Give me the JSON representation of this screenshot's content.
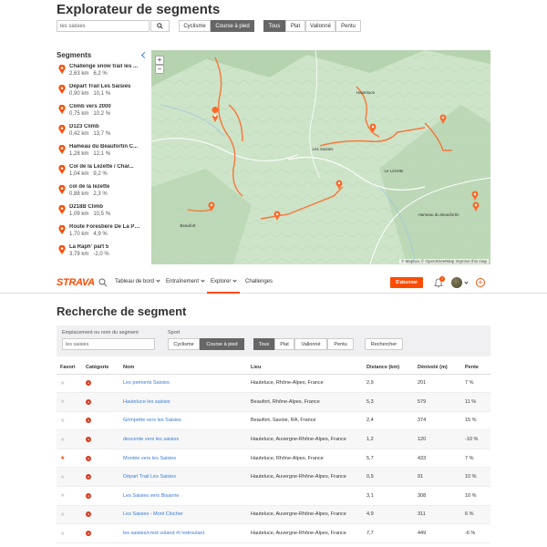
{
  "explorer": {
    "title": "Explorateur de segments",
    "search_value": "les saisies",
    "sport_options": [
      "Cyclisme",
      "Course à pied"
    ],
    "sport_selected": "Course à pied",
    "terrain_options": [
      "Tous",
      "Plat",
      "Vallonné",
      "Pentu"
    ],
    "terrain_selected": "Tous",
    "segments_heading": "Segments",
    "segments": [
      {
        "name": "Challenge snow trail les ...",
        "distance": "2,63 km",
        "grade": "6,2 %"
      },
      {
        "name": "Départ Trail Les Saisies",
        "distance": "0,90 km",
        "grade": "10,1 %"
      },
      {
        "name": "Climb vers 2000",
        "distance": "0,75 km",
        "grade": "10,2 %"
      },
      {
        "name": "D123 Climb",
        "distance": "0,42 km",
        "grade": "13,7 %"
      },
      {
        "name": "Hameau du Beaufortin C...",
        "distance": "1,28 km",
        "grade": "12,1 %"
      },
      {
        "name": "Col de la Lézette / Char...",
        "distance": "1,04 km",
        "grade": "9,2 %"
      },
      {
        "name": "col de la lezette",
        "distance": "0,88 km",
        "grade": "2,3 %"
      },
      {
        "name": "D218B Climb",
        "distance": "1,09 km",
        "grade": "10,5 %"
      },
      {
        "name": "Route Forestière De La Pa...",
        "distance": "1,70 km",
        "grade": "4,9 %"
      },
      {
        "name": "La Raph' part 5",
        "distance": "3,79 km",
        "grade": "-2,0 %"
      }
    ],
    "map": {
      "zoom_in": "+",
      "zoom_out": "−",
      "attribution": "© Mapbox © OpenStreetMap Improve this map",
      "place_labels": [
        "Les Saisies",
        "Hauteluce",
        "Le Lézette",
        "Beaufort",
        "Hameau du Beaufortin"
      ]
    }
  },
  "nav": {
    "logo": "STRAVA",
    "items": [
      "Tableau de bord",
      "Entraînement",
      "Explorer",
      "Challenges"
    ],
    "subscribe": "S'abonner",
    "notif_count": "1",
    "add": "+"
  },
  "search": {
    "title": "Recherche de segment",
    "location_label": "Emplacement ou nom du segment",
    "location_value": "les saisies",
    "sport_label": "Sport",
    "sport_options": [
      "Cyclisme",
      "Course à pied"
    ],
    "terrain_options": [
      "Tous",
      "Plat",
      "Vallonné",
      "Pentu"
    ],
    "submit": "Rechercher"
  },
  "table": {
    "headers": [
      "Favori",
      "Catégorie",
      "Nom",
      "Lieu",
      "Distance (km)",
      "Dénivelé (m)",
      "Pente"
    ],
    "rows": [
      {
        "fav": false,
        "name": "Les pemonts Saisies",
        "place": "Hauteluce, Rhône-Alpes, France",
        "distance": "2,9",
        "elev": "201",
        "grade": "7 %"
      },
      {
        "fav": false,
        "name": "Hauteluce les saisies",
        "place": "Beaufort, Rhône-Alpes, France",
        "distance": "5,3",
        "elev": "579",
        "grade": "11 %"
      },
      {
        "fav": false,
        "name": "Grimpette vers les Saisies",
        "place": "Beaufort, Savoie, RA, France",
        "distance": "2,4",
        "elev": "374",
        "grade": "15 %"
      },
      {
        "fav": false,
        "name": "descente vers les saisies",
        "place": "Hauteluce, Auvergne-Rhône-Alpes, France",
        "distance": "1,2",
        "elev": "120",
        "grade": "-10 %"
      },
      {
        "fav": true,
        "name": "Montée vers les Saisies",
        "place": "Hauteluce, Rhône-Alpes, France",
        "distance": "5,7",
        "elev": "433",
        "grade": "7 %"
      },
      {
        "fav": false,
        "name": "Départ Trail Les Saisies",
        "place": "Hauteluce, Auvergne-Rhône-Alpes, France",
        "distance": "0,9",
        "elev": "91",
        "grade": "10 %"
      },
      {
        "fav": false,
        "name": "Les Saisies vers Bisanne",
        "place": "",
        "distance": "3,1",
        "elev": "308",
        "grade": "10 %"
      },
      {
        "fav": false,
        "name": "Les Saisies - Mont Clocher",
        "place": "Hauteluce, Auvergne-Rhône-Alpes, France",
        "distance": "4,9",
        "elev": "311",
        "grade": "6 %"
      },
      {
        "fav": false,
        "name": "les saisies/crest voland #c'estroulant",
        "place": "Hauteluce, Auvergne-Rhône-Alpes, France",
        "distance": "7,7",
        "elev": "449",
        "grade": "-6 %"
      }
    ]
  },
  "colors": {
    "brand": "#fc4c02",
    "link": "#3a7bd5",
    "active_btn": "#666666"
  }
}
